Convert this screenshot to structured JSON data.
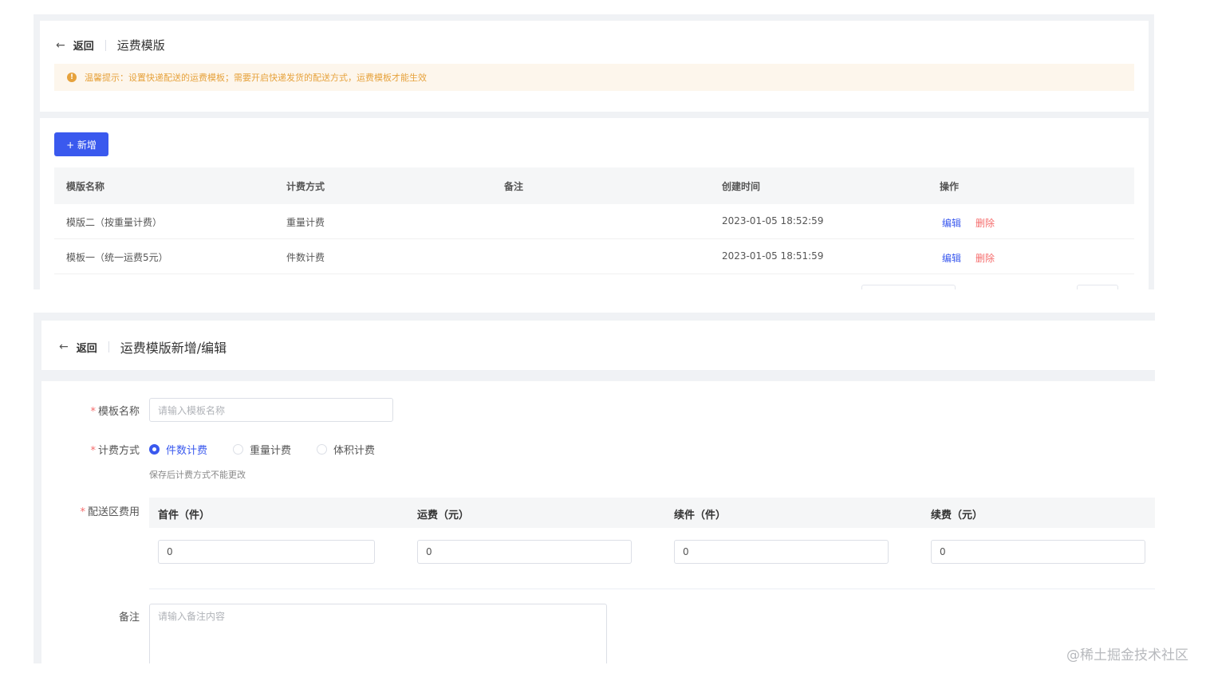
{
  "list_page": {
    "back_label": "返回",
    "title": "运费模版",
    "alert": {
      "icon": "info-circle-icon",
      "text": "温馨提示：设置快递配送的运费模板；需要开启快递发货的配送方式，运费模板才能生效"
    },
    "add_button": "+ 新增",
    "columns": [
      "模版名称",
      "计费方式",
      "备注",
      "创建时间",
      "操作"
    ],
    "rows": [
      {
        "name": "模版二（按重量计费）",
        "billing": "重量计费",
        "remark": "",
        "created": "2023-01-05 18:52:59",
        "edit": "编辑",
        "delete": "删除"
      },
      {
        "name": "模板一（统一运费5元）",
        "billing": "件数计费",
        "remark": "",
        "created": "2023-01-05 18:51:59",
        "edit": "编辑",
        "delete": "删除"
      }
    ]
  },
  "edit_page": {
    "back_label": "返回",
    "title": "运费模版新增/编辑",
    "form": {
      "name_label": "模板名称",
      "name_placeholder": "请输入模板名称",
      "billing_label": "计费方式",
      "billing_options": [
        {
          "label": "件数计费",
          "selected": true
        },
        {
          "label": "重量计费",
          "selected": false
        },
        {
          "label": "体积计费",
          "selected": false
        }
      ],
      "billing_hint": "保存后计费方式不能更改",
      "fee_label": "配送区费用",
      "fee_columns": [
        "首件（件）",
        "运费（元）",
        "续件（件）",
        "续费（元）"
      ],
      "fee_values": [
        "0",
        "0",
        "0",
        "0"
      ],
      "remark_label": "备注",
      "remark_placeholder": "请输入备注内容"
    }
  },
  "watermark": "@稀土掘金技术社区",
  "colors": {
    "primary": "#3a59ee",
    "danger": "#f56c6c",
    "warning": "#e6a23c"
  }
}
